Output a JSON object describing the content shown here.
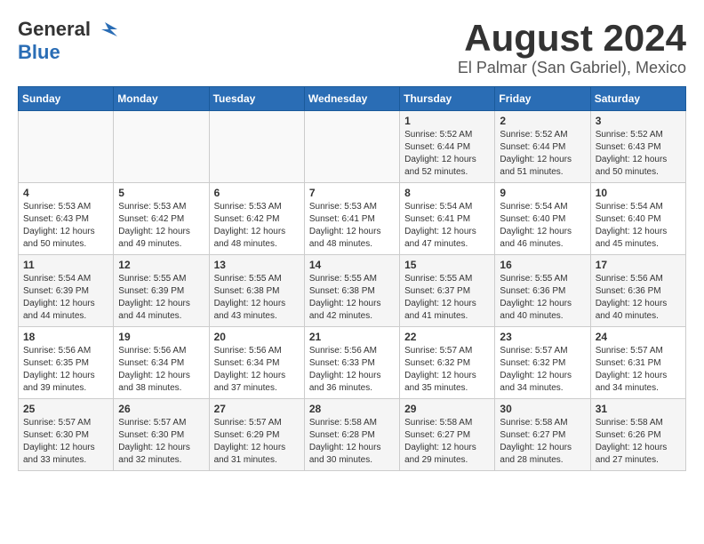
{
  "header": {
    "logo_general": "General",
    "logo_blue": "Blue",
    "month_year": "August 2024",
    "location": "El Palmar (San Gabriel), Mexico"
  },
  "days_of_week": [
    "Sunday",
    "Monday",
    "Tuesday",
    "Wednesday",
    "Thursday",
    "Friday",
    "Saturday"
  ],
  "weeks": [
    [
      {
        "day": "",
        "info": ""
      },
      {
        "day": "",
        "info": ""
      },
      {
        "day": "",
        "info": ""
      },
      {
        "day": "",
        "info": ""
      },
      {
        "day": "1",
        "info": "Sunrise: 5:52 AM\nSunset: 6:44 PM\nDaylight: 12 hours\nand 52 minutes."
      },
      {
        "day": "2",
        "info": "Sunrise: 5:52 AM\nSunset: 6:44 PM\nDaylight: 12 hours\nand 51 minutes."
      },
      {
        "day": "3",
        "info": "Sunrise: 5:52 AM\nSunset: 6:43 PM\nDaylight: 12 hours\nand 50 minutes."
      }
    ],
    [
      {
        "day": "4",
        "info": "Sunrise: 5:53 AM\nSunset: 6:43 PM\nDaylight: 12 hours\nand 50 minutes."
      },
      {
        "day": "5",
        "info": "Sunrise: 5:53 AM\nSunset: 6:42 PM\nDaylight: 12 hours\nand 49 minutes."
      },
      {
        "day": "6",
        "info": "Sunrise: 5:53 AM\nSunset: 6:42 PM\nDaylight: 12 hours\nand 48 minutes."
      },
      {
        "day": "7",
        "info": "Sunrise: 5:53 AM\nSunset: 6:41 PM\nDaylight: 12 hours\nand 48 minutes."
      },
      {
        "day": "8",
        "info": "Sunrise: 5:54 AM\nSunset: 6:41 PM\nDaylight: 12 hours\nand 47 minutes."
      },
      {
        "day": "9",
        "info": "Sunrise: 5:54 AM\nSunset: 6:40 PM\nDaylight: 12 hours\nand 46 minutes."
      },
      {
        "day": "10",
        "info": "Sunrise: 5:54 AM\nSunset: 6:40 PM\nDaylight: 12 hours\nand 45 minutes."
      }
    ],
    [
      {
        "day": "11",
        "info": "Sunrise: 5:54 AM\nSunset: 6:39 PM\nDaylight: 12 hours\nand 44 minutes."
      },
      {
        "day": "12",
        "info": "Sunrise: 5:55 AM\nSunset: 6:39 PM\nDaylight: 12 hours\nand 44 minutes."
      },
      {
        "day": "13",
        "info": "Sunrise: 5:55 AM\nSunset: 6:38 PM\nDaylight: 12 hours\nand 43 minutes."
      },
      {
        "day": "14",
        "info": "Sunrise: 5:55 AM\nSunset: 6:38 PM\nDaylight: 12 hours\nand 42 minutes."
      },
      {
        "day": "15",
        "info": "Sunrise: 5:55 AM\nSunset: 6:37 PM\nDaylight: 12 hours\nand 41 minutes."
      },
      {
        "day": "16",
        "info": "Sunrise: 5:55 AM\nSunset: 6:36 PM\nDaylight: 12 hours\nand 40 minutes."
      },
      {
        "day": "17",
        "info": "Sunrise: 5:56 AM\nSunset: 6:36 PM\nDaylight: 12 hours\nand 40 minutes."
      }
    ],
    [
      {
        "day": "18",
        "info": "Sunrise: 5:56 AM\nSunset: 6:35 PM\nDaylight: 12 hours\nand 39 minutes."
      },
      {
        "day": "19",
        "info": "Sunrise: 5:56 AM\nSunset: 6:34 PM\nDaylight: 12 hours\nand 38 minutes."
      },
      {
        "day": "20",
        "info": "Sunrise: 5:56 AM\nSunset: 6:34 PM\nDaylight: 12 hours\nand 37 minutes."
      },
      {
        "day": "21",
        "info": "Sunrise: 5:56 AM\nSunset: 6:33 PM\nDaylight: 12 hours\nand 36 minutes."
      },
      {
        "day": "22",
        "info": "Sunrise: 5:57 AM\nSunset: 6:32 PM\nDaylight: 12 hours\nand 35 minutes."
      },
      {
        "day": "23",
        "info": "Sunrise: 5:57 AM\nSunset: 6:32 PM\nDaylight: 12 hours\nand 34 minutes."
      },
      {
        "day": "24",
        "info": "Sunrise: 5:57 AM\nSunset: 6:31 PM\nDaylight: 12 hours\nand 34 minutes."
      }
    ],
    [
      {
        "day": "25",
        "info": "Sunrise: 5:57 AM\nSunset: 6:30 PM\nDaylight: 12 hours\nand 33 minutes."
      },
      {
        "day": "26",
        "info": "Sunrise: 5:57 AM\nSunset: 6:30 PM\nDaylight: 12 hours\nand 32 minutes."
      },
      {
        "day": "27",
        "info": "Sunrise: 5:57 AM\nSunset: 6:29 PM\nDaylight: 12 hours\nand 31 minutes."
      },
      {
        "day": "28",
        "info": "Sunrise: 5:58 AM\nSunset: 6:28 PM\nDaylight: 12 hours\nand 30 minutes."
      },
      {
        "day": "29",
        "info": "Sunrise: 5:58 AM\nSunset: 6:27 PM\nDaylight: 12 hours\nand 29 minutes."
      },
      {
        "day": "30",
        "info": "Sunrise: 5:58 AM\nSunset: 6:27 PM\nDaylight: 12 hours\nand 28 minutes."
      },
      {
        "day": "31",
        "info": "Sunrise: 5:58 AM\nSunset: 6:26 PM\nDaylight: 12 hours\nand 27 minutes."
      }
    ]
  ]
}
